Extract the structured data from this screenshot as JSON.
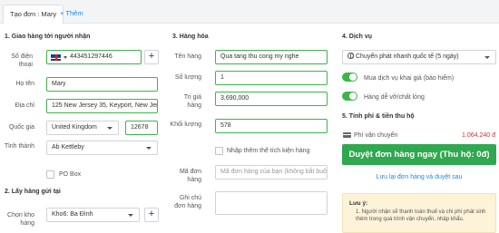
{
  "tabs": {
    "active_label": "Tạo đơn : Mary",
    "add_label": "Thêm",
    "add_icon": "plus-icon"
  },
  "receiver": {
    "title": "1. Giao hàng tới người nhận",
    "phone_label": "Số điện thoại",
    "phone_country": "united-kingdom-flag-icon",
    "phone_value": "443451297446",
    "name_label": "Họ tên",
    "name_value": "Mary",
    "address_label": "Địa chỉ",
    "address_value": "125 New Jersey 35, Keyport, New Jersey",
    "country_label": "Quốc gia",
    "country_value": "United Kingdom",
    "postcode_value": "12678",
    "province_label": "Tỉnh thành",
    "province_value": "Ab Kettleby",
    "pobox_label": "PO Box"
  },
  "pickup": {
    "title": "2. Lấy hàng gửi tại",
    "warehouse_label": "Chọn kho hàng",
    "warehouse_value": "Kho6: Ba Đình"
  },
  "goods": {
    "title": "3. Hàng hóa",
    "name_label": "Tên hàng",
    "name_value": "Qua tang thu cong my nghe",
    "qty_label": "Số lượng",
    "qty_value": "1",
    "value_label": "Trị giá hàng",
    "value_value": "3,690,000",
    "weight_label": "Khối lượng",
    "weight_value": "578",
    "volume_label": "Nhập thêm thể tích kiện hàng",
    "code_label": "Mã đơn hàng",
    "code_placeholder": "Mã đơn hàng của bạn (không bắt buộc)",
    "note_label": "Ghi chú đơn hàng"
  },
  "service": {
    "title": "4. Dịch vụ",
    "service_value": "Chuyển phát nhanh quốc tế (5 ngày)",
    "insurance_label": "Mua dịch vụ khai giá (bảo hiểm)",
    "fragile_label": "Hàng dễ vỡ/chất lỏng",
    "fee_title": "5. Tính phí & tiền thu hộ",
    "fee_label": "Phí vận chuyển",
    "fee_value": "1.064.240 đ",
    "fee_color": "#d32f2f",
    "submit_label": "Duyệt đơn hàng ngay (Thu hộ: 0đ)",
    "save_label": "Lưu lại đơn hàng và duyệt sau",
    "note_title": "Lưu ý:",
    "note_item": "1. Người nhận sẽ thanh toán thuế và chi phí phát sinh thêm trong quá trình vận chuyển, nhập khẩu."
  },
  "colors": {
    "accent": "#1e88e5",
    "success": "#3cb54a",
    "button": "#2fa84f"
  }
}
